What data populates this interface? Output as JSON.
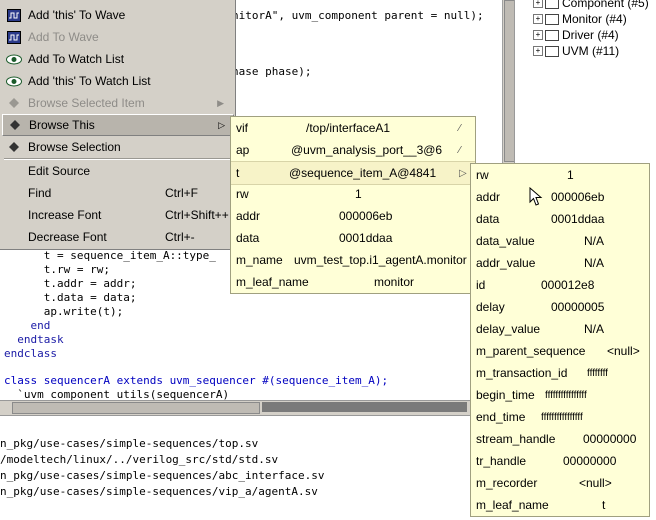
{
  "editor": {
    "lines": [
      {
        "text": "nitorA\", uvm_component parent = null);",
        "style": "normal"
      },
      {
        "text": "hase phase);",
        "style": "normal"
      },
      {
        "text": "      t = sequence_item_A::type_",
        "style": "normal"
      },
      {
        "text": "      t.rw = rw;",
        "style": "normal"
      },
      {
        "text": "      t.addr = addr;",
        "style": "normal"
      },
      {
        "text": "      t.data = data;",
        "style": "normal"
      },
      {
        "text": "      ap.write(t);",
        "style": "normal"
      },
      {
        "text": "    end",
        "style": "blue"
      },
      {
        "text": "  endtask",
        "style": "blue"
      },
      {
        "text": "endclass",
        "style": "blue"
      },
      {
        "text": "class sequencerA extends uvm_sequencer #(sequence_item_A);",
        "style": "kw"
      },
      {
        "text": "  `uvm_component_utils(sequencerA)",
        "style": "normal"
      }
    ]
  },
  "tree": {
    "items": [
      {
        "label": "Component (#5)",
        "expander": "+"
      },
      {
        "label": "Monitor (#4)",
        "expander": "+"
      },
      {
        "label": "Driver (#4)",
        "expander": "+"
      },
      {
        "label": "UVM (#11)",
        "expander": "+"
      }
    ]
  },
  "files": [
    "n_pkg/use-cases/simple-sequences/top.sv",
    "/modeltech/linux/../verilog_src/std/std.sv",
    "n_pkg/use-cases/simple-sequences/abc_interface.sv",
    "n_pkg/use-cases/simple-sequences/vip_a/agentA.sv"
  ],
  "context_menu": {
    "items": [
      {
        "label": "Add 'this' To Wave",
        "icon": "wave-icon",
        "enabled": true
      },
      {
        "label": "Add To Wave",
        "icon": "wave-icon",
        "enabled": false
      },
      {
        "label": "Add To Watch List",
        "icon": "eye-icon",
        "enabled": true
      },
      {
        "label": "Add 'this' To Watch List",
        "icon": "eye-icon",
        "enabled": true
      },
      {
        "label": "Browse Selected Item",
        "icon": "diamond-icon",
        "enabled": false,
        "submenu": true
      },
      {
        "label": "Browse This",
        "icon": "diamond-icon",
        "enabled": true,
        "submenu": true,
        "selected": true
      },
      {
        "label": "Browse Selection",
        "icon": "diamond-icon",
        "enabled": true
      },
      {
        "label": "Edit Source",
        "enabled": true
      },
      {
        "label": "Find",
        "shortcut": "Ctrl+F",
        "enabled": true
      },
      {
        "label": "Increase Font",
        "shortcut": "Ctrl+Shift++",
        "enabled": true
      },
      {
        "label": "Decrease Font",
        "shortcut": "Ctrl+-",
        "enabled": true
      }
    ]
  },
  "browse_this": {
    "rows": [
      {
        "key": "vif",
        "value": "/top/interfaceA1",
        "expandable": true
      },
      {
        "key": "ap",
        "value": "@uvm_analysis_port__3@6",
        "expandable": true
      },
      {
        "key": "t",
        "value": "@sequence_item_A@4841",
        "expandable": true,
        "selected": true
      },
      {
        "key": "rw",
        "value": "1"
      },
      {
        "key": "addr",
        "value": "000006eb"
      },
      {
        "key": "data",
        "value": "0001ddaa"
      },
      {
        "key": "m_name",
        "value": "uvm_test_top.i1_agentA.monitor"
      },
      {
        "key": "m_leaf_name",
        "value": "monitor"
      }
    ]
  },
  "seq_item": {
    "rows": [
      {
        "key": "rw",
        "value": "1"
      },
      {
        "key": "addr",
        "value": "000006eb"
      },
      {
        "key": "data",
        "value": "0001ddaa"
      },
      {
        "key": "data_value",
        "value": "N/A"
      },
      {
        "key": "addr_value",
        "value": "N/A"
      },
      {
        "key": "id",
        "value": "000012e8"
      },
      {
        "key": "delay",
        "value": "00000005"
      },
      {
        "key": "delay_value",
        "value": "N/A"
      },
      {
        "key": "m_parent_sequence",
        "value": "<null>"
      },
      {
        "key": "m_transaction_id",
        "value": "ffffffff"
      },
      {
        "key": "begin_time",
        "value": "ffffffffffffffff"
      },
      {
        "key": "end_time",
        "value": "ffffffffffffffff"
      },
      {
        "key": "stream_handle",
        "value": "00000000"
      },
      {
        "key": "tr_handle",
        "value": "00000000"
      },
      {
        "key": "m_recorder",
        "value": "<null>"
      },
      {
        "key": "m_leaf_name",
        "value": "t"
      }
    ]
  }
}
